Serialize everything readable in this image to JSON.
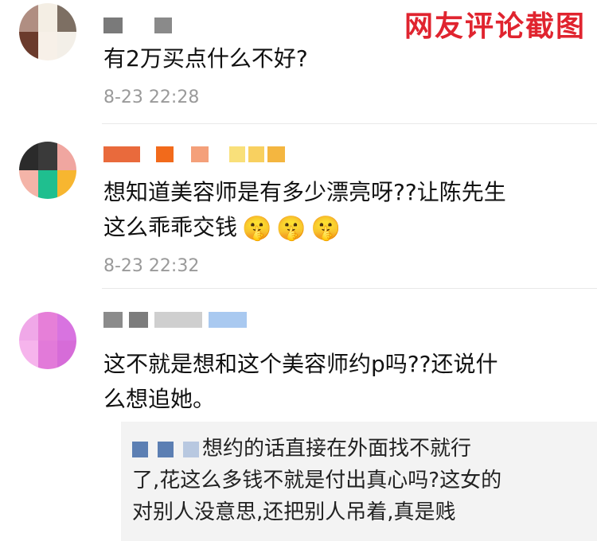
{
  "watermark": "网友评论截图",
  "comments": [
    {
      "text": "有2万买点什么不好?",
      "time": "8-23 22:28",
      "avatar_colors": [
        "#b08e82",
        "#f4eee4",
        "#7d6f63",
        "#6b3b2c",
        "#f7f0e8",
        "#f3efe8"
      ],
      "username_colors": [
        "#7a7a7a",
        "#8a8a8a"
      ]
    },
    {
      "text_line1": "想知道美容师是有多少漂亮呀??让陈先生",
      "text_line2": "这么乖乖交钱",
      "emoji": "🤫",
      "time": "8-23 22:32",
      "avatar_colors": [
        "#2b2b2b",
        "#3a3a3a",
        "#f0a6a0",
        "#f4b4a8",
        "#1fbf8f",
        "#f7b630"
      ],
      "username_colors": [
        "#e96a3c",
        "#f26a1b",
        "#f4a07a",
        "#f9e07a",
        "#f8d060",
        "#f4b640"
      ]
    },
    {
      "text_line1": "这不就是想和这个美容师约p吗??还说什",
      "text_line2": "么想追她。",
      "avatar_colors": [
        "#f0a8e8",
        "#e67fd8",
        "#d873e0",
        "#f6b4ec",
        "#e27ad9",
        "#d66cd8"
      ],
      "username_colors": [
        "#8b8b8b",
        "#7c7c7c",
        "#cfcfcf",
        "#a9c9f0"
      ],
      "reply": {
        "text_line1": "想约的话直接在外面找不就行",
        "text_line2": "了,花这么多钱不就是付出真心吗?这女的",
        "text_line3": "对别人没意思,还把别人吊着,真是贱"
      }
    }
  ]
}
